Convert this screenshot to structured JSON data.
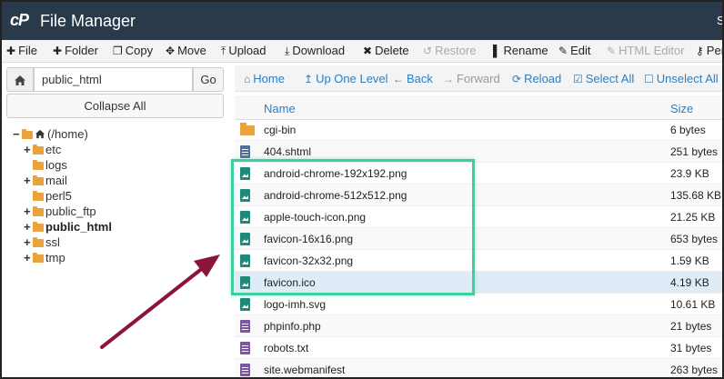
{
  "app": {
    "logo_text": "cP",
    "title": "File Manager",
    "user_initial": "S"
  },
  "toolbar": [
    {
      "icon": "plus-icon",
      "glyph": "✚",
      "label": "File",
      "disabled": false
    },
    {
      "icon": "plus-icon",
      "glyph": "✚",
      "label": "Folder",
      "disabled": false
    },
    {
      "icon": "copy-icon",
      "glyph": "❐",
      "label": "Copy",
      "disabled": false
    },
    {
      "icon": "move-icon",
      "glyph": "✥",
      "label": "Move",
      "disabled": false
    },
    {
      "icon": "upload-icon",
      "glyph": "⤒",
      "label": "Upload",
      "disabled": false
    },
    {
      "icon": "download-icon",
      "glyph": "⤓",
      "label": "Download",
      "disabled": false
    },
    {
      "icon": "close-icon",
      "glyph": "✖",
      "label": "Delete",
      "disabled": false
    },
    {
      "icon": "restore-icon",
      "glyph": "↺",
      "label": "Restore",
      "disabled": true
    },
    {
      "icon": "document-icon",
      "glyph": "▌",
      "label": "Rename",
      "disabled": false
    },
    {
      "icon": "pencil-icon",
      "glyph": "✎",
      "label": "Edit",
      "disabled": false
    },
    {
      "icon": "html-editor-icon",
      "glyph": "✎",
      "label": "HTML Editor",
      "disabled": true
    },
    {
      "icon": "key-icon",
      "glyph": "⚷",
      "label": "Per",
      "disabled": false
    }
  ],
  "left_panel": {
    "path_value": "public_html",
    "go_label": "Go",
    "collapse_label": "Collapse All",
    "tree": [
      {
        "label": "(/home)",
        "toggle": "−",
        "level": 0,
        "bold": false,
        "home": true
      },
      {
        "label": "etc",
        "toggle": "+",
        "level": 1,
        "bold": false
      },
      {
        "label": "logs",
        "toggle": "",
        "level": 1,
        "bold": false
      },
      {
        "label": "mail",
        "toggle": "+",
        "level": 1,
        "bold": false
      },
      {
        "label": "perl5",
        "toggle": "",
        "level": 1,
        "bold": false
      },
      {
        "label": "public_ftp",
        "toggle": "+",
        "level": 1,
        "bold": false
      },
      {
        "label": "public_html",
        "toggle": "+",
        "level": 1,
        "bold": true
      },
      {
        "label": "ssl",
        "toggle": "+",
        "level": 1,
        "bold": false
      },
      {
        "label": "tmp",
        "toggle": "+",
        "level": 1,
        "bold": false
      }
    ]
  },
  "right_toolbar": [
    {
      "icon": "home-icon",
      "glyph": "⌂",
      "label": "Home",
      "disabled": false
    },
    {
      "icon": "level-up-icon",
      "glyph": "↥",
      "label": "Up One Level",
      "disabled": false
    },
    {
      "icon": "arrow-left-icon",
      "glyph": "←",
      "label": "Back",
      "disabled": false
    },
    {
      "icon": "arrow-right-icon",
      "glyph": "→",
      "label": "Forward",
      "disabled": true
    },
    {
      "icon": "reload-icon",
      "glyph": "⟳",
      "label": "Reload",
      "disabled": false
    },
    {
      "icon": "check-square-icon",
      "glyph": "☑",
      "label": "Select All",
      "disabled": false
    },
    {
      "icon": "square-icon",
      "glyph": "☐",
      "label": "Unselect All",
      "disabled": false
    }
  ],
  "table": {
    "headers": {
      "name": "Name",
      "size": "Size"
    },
    "rows": [
      {
        "name": "cgi-bin",
        "size": "6 bytes",
        "type": "folder",
        "selected": false
      },
      {
        "name": "404.shtml",
        "size": "251 bytes",
        "type": "html",
        "selected": false
      },
      {
        "name": "android-chrome-192x192.png",
        "size": "23.9 KB",
        "type": "image",
        "selected": false
      },
      {
        "name": "android-chrome-512x512.png",
        "size": "135.68 KB",
        "type": "image",
        "selected": false
      },
      {
        "name": "apple-touch-icon.png",
        "size": "21.25 KB",
        "type": "image",
        "selected": false
      },
      {
        "name": "favicon-16x16.png",
        "size": "653 bytes",
        "type": "image",
        "selected": false
      },
      {
        "name": "favicon-32x32.png",
        "size": "1.59 KB",
        "type": "image",
        "selected": false
      },
      {
        "name": "favicon.ico",
        "size": "4.19 KB",
        "type": "image",
        "selected": true
      },
      {
        "name": "logo-imh.svg",
        "size": "10.61 KB",
        "type": "image",
        "selected": false
      },
      {
        "name": "phpinfo.php",
        "size": "21 bytes",
        "type": "php",
        "selected": false
      },
      {
        "name": "robots.txt",
        "size": "31 bytes",
        "type": "text",
        "selected": false
      },
      {
        "name": "site.webmanifest",
        "size": "263 bytes",
        "type": "text",
        "selected": false
      }
    ]
  },
  "colors": {
    "header_bg": "#293a4a",
    "link_blue": "#2c7ec3",
    "highlight_green": "#3fcf9f",
    "arrow_maroon": "#8b1538",
    "folder_orange": "#e8a33d",
    "selected_row": "#dfecf7"
  }
}
